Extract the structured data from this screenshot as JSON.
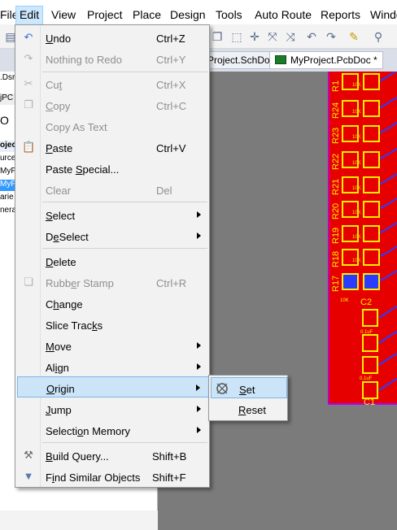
{
  "menubar": {
    "items": [
      "File",
      "Edit",
      "View",
      "Project",
      "Place",
      "Design",
      "Tools",
      "Auto Route",
      "Reports",
      "Window"
    ],
    "active": "Edit"
  },
  "tabs": [
    "Project.SchDoc",
    "MyProject.PcbDoc *"
  ],
  "left_panel": {
    "rows": [
      ".Dsr",
      "jPC",
      "O",
      "ojec",
      "urce",
      "MyP",
      "MyP",
      "arie",
      "nera"
    ]
  },
  "edit_menu": {
    "undo": {
      "label": "Undo",
      "shortcut": "Ctrl+Z"
    },
    "redo": {
      "label": "Nothing to Redo",
      "shortcut": "Ctrl+Y"
    },
    "cut": {
      "label": "Cut",
      "shortcut": "Ctrl+X"
    },
    "copy": {
      "label": "Copy",
      "shortcut": "Ctrl+C"
    },
    "copy_as_text": {
      "label": "Copy As Text"
    },
    "paste": {
      "label": "Paste",
      "shortcut": "Ctrl+V"
    },
    "paste_special": {
      "label": "Paste Special..."
    },
    "clear": {
      "label": "Clear",
      "shortcut": "Del"
    },
    "select": {
      "label": "Select"
    },
    "deselect": {
      "label": "DeSelect"
    },
    "delete": {
      "label": "Delete"
    },
    "rubber_stamp": {
      "label": "Rubber Stamp",
      "shortcut": "Ctrl+R"
    },
    "change": {
      "label": "Change"
    },
    "slice_tracks": {
      "label": "Slice Tracks"
    },
    "move": {
      "label": "Move"
    },
    "align": {
      "label": "Align"
    },
    "origin": {
      "label": "Origin"
    },
    "jump": {
      "label": "Jump"
    },
    "selection_memory": {
      "label": "Selection Memory"
    },
    "build_query": {
      "label": "Build Query...",
      "shortcut": "Shift+B"
    },
    "find_similar": {
      "label": "Find Similar Objects",
      "shortcut": "Shift+F"
    }
  },
  "origin_submenu": {
    "set": "Set",
    "reset": "Reset"
  },
  "pcb": {
    "designators": [
      "R1",
      "R24",
      "R23",
      "R22",
      "R21",
      "R20",
      "R19",
      "R18",
      "R17"
    ],
    "pad_labels": [
      "10K",
      "10K",
      "10K",
      "10K",
      "10K",
      "10K",
      "10K",
      "10K",
      "10K"
    ],
    "cap_c2": "C2",
    "cap_c1": "C1",
    "cap_value": "0.1uF",
    "colors": {
      "board": "#e60000",
      "silk": "#ffee00",
      "outline": "#b000ff",
      "trace": "#2b3cff"
    }
  },
  "colors": {
    "menu_hover": "#cce4f7",
    "menu_hover_border": "#7eb4ea",
    "canvas": "#7b7b7b"
  }
}
